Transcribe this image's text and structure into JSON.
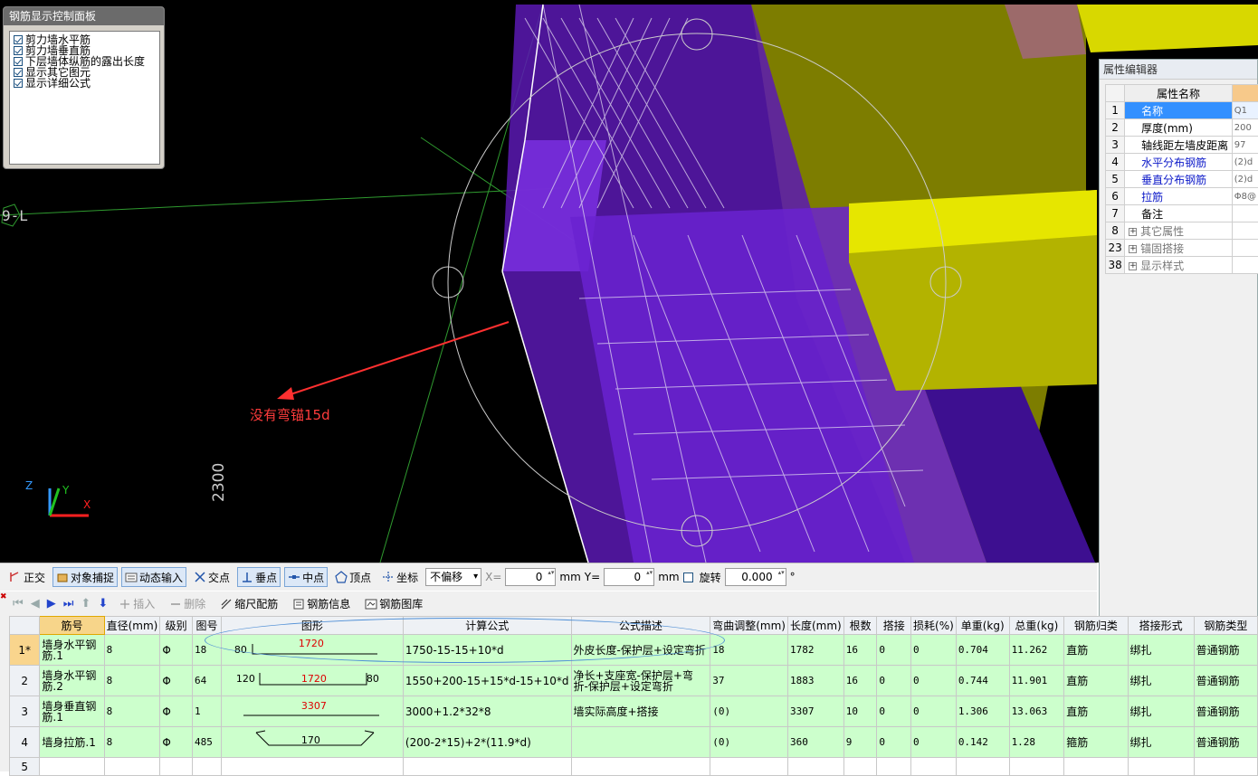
{
  "control_panel": {
    "title": "钢筋显示控制面板",
    "options": [
      {
        "label": "剪力墙水平筋",
        "checked": true
      },
      {
        "label": "剪力墙垂直筋",
        "checked": true
      },
      {
        "label": "下层墙体纵筋的露出长度",
        "checked": true
      },
      {
        "label": "显示其它图元",
        "checked": true
      },
      {
        "label": "显示详细公式",
        "checked": true
      }
    ]
  },
  "viewport": {
    "axis_tag": "9-L",
    "annotation": "没有弯锚15d",
    "dimension": "2300",
    "axis_names": {
      "z": "Z",
      "y": "Y",
      "x": "X"
    }
  },
  "property_editor": {
    "title": "属性编辑器",
    "header": "属性名称",
    "rows": [
      {
        "idx": "1",
        "name": "名称",
        "value": "Q1",
        "style": "blue",
        "selected": true
      },
      {
        "idx": "2",
        "name": "厚度(mm)",
        "value": "200",
        "style": "normal"
      },
      {
        "idx": "3",
        "name": "轴线距左墙皮距离",
        "value": "97",
        "style": "normal"
      },
      {
        "idx": "4",
        "name": "水平分布钢筋",
        "value": "(2)d",
        "style": "blue"
      },
      {
        "idx": "5",
        "name": "垂直分布钢筋",
        "value": "(2)d",
        "style": "blue"
      },
      {
        "idx": "6",
        "name": "拉筋",
        "value": "Φ8@",
        "style": "blue"
      },
      {
        "idx": "7",
        "name": "备注",
        "value": "",
        "style": "normal"
      },
      {
        "idx": "8",
        "name": "其它属性",
        "value": "",
        "style": "group"
      },
      {
        "idx": "23",
        "name": "锚固搭接",
        "value": "",
        "style": "group"
      },
      {
        "idx": "38",
        "name": "显示样式",
        "value": "",
        "style": "group"
      }
    ]
  },
  "toolbar": {
    "ortho": "正交",
    "snap": "对象捕捉",
    "dynamic_input": "动态输入",
    "intersection": "交点",
    "perpendicular": "垂点",
    "midpoint": "中点",
    "vertex": "顶点",
    "coordinate": "坐标",
    "offset_mode": "不偏移",
    "x_label": "X=",
    "x_value": "0",
    "y_label": "Y=",
    "y_value": "0",
    "unit": "mm",
    "rotate": "旋转",
    "rotate_value": "0.000",
    "degree": "°"
  },
  "toolbar2": {
    "insert": "插入",
    "delete": "删除",
    "scale_rebar": "缩尺配筋",
    "rebar_info": "钢筋信息",
    "rebar_drawing": "钢筋图库"
  },
  "grid": {
    "headers": [
      "筋号",
      "直径(mm)",
      "级别",
      "图号",
      "图形",
      "计算公式",
      "公式描述",
      "弯曲调整(mm)",
      "长度(mm)",
      "根数",
      "搭接",
      "损耗(%)",
      "单重(kg)",
      "总重(kg)",
      "钢筋归类",
      "搭接形式",
      "钢筋类型"
    ],
    "rows": [
      {
        "rn": "1*",
        "name": "墙身水平钢筋.1",
        "dia": "8",
        "grade": "Φ",
        "fig": "18",
        "shape": {
          "left": "80",
          "mid": "1720",
          "right": ""
        },
        "formula": "1750-15-15+10*d",
        "desc": "外皮长度-保护层+设定弯折",
        "bend": "18",
        "len": "1782",
        "count": "16",
        "lap": "0",
        "loss": "0",
        "unit_w": "0.704",
        "total_w": "11.262",
        "cat": "直筋",
        "lap_type": "绑扎",
        "type": "普通钢筋"
      },
      {
        "rn": "2",
        "name": "墙身水平钢筋.2",
        "dia": "8",
        "grade": "Φ",
        "fig": "64",
        "shape": {
          "left": "120",
          "mid": "1720",
          "right": "80"
        },
        "formula": "1550+200-15+15*d-15+10*d",
        "desc": "净长+支座宽-保护层+弯折-保护层+设定弯折",
        "bend": "37",
        "len": "1883",
        "count": "16",
        "lap": "0",
        "loss": "0",
        "unit_w": "0.744",
        "total_w": "11.901",
        "cat": "直筋",
        "lap_type": "绑扎",
        "type": "普通钢筋"
      },
      {
        "rn": "3",
        "name": "墙身垂直钢筋.1",
        "dia": "8",
        "grade": "Φ",
        "fig": "1",
        "shape": {
          "left": "",
          "mid": "3307",
          "right": ""
        },
        "formula": "3000+1.2*32*8",
        "desc": "墙实际高度+搭接",
        "bend": "(0)",
        "len": "3307",
        "count": "10",
        "lap": "0",
        "loss": "0",
        "unit_w": "1.306",
        "total_w": "13.063",
        "cat": "直筋",
        "lap_type": "绑扎",
        "type": "普通钢筋"
      },
      {
        "rn": "4",
        "name": "墙身拉筋.1",
        "dia": "8",
        "grade": "Φ",
        "fig": "485",
        "shape": {
          "left": "",
          "mid": "170",
          "right": ""
        },
        "formula": "(200-2*15)+2*(11.9*d)",
        "desc": "",
        "bend": "(0)",
        "len": "360",
        "count": "9",
        "lap": "0",
        "loss": "0",
        "unit_w": "0.142",
        "total_w": "1.28",
        "cat": "箍筋",
        "lap_type": "绑扎",
        "type": "普通钢筋"
      }
    ],
    "empty_row": "5"
  }
}
